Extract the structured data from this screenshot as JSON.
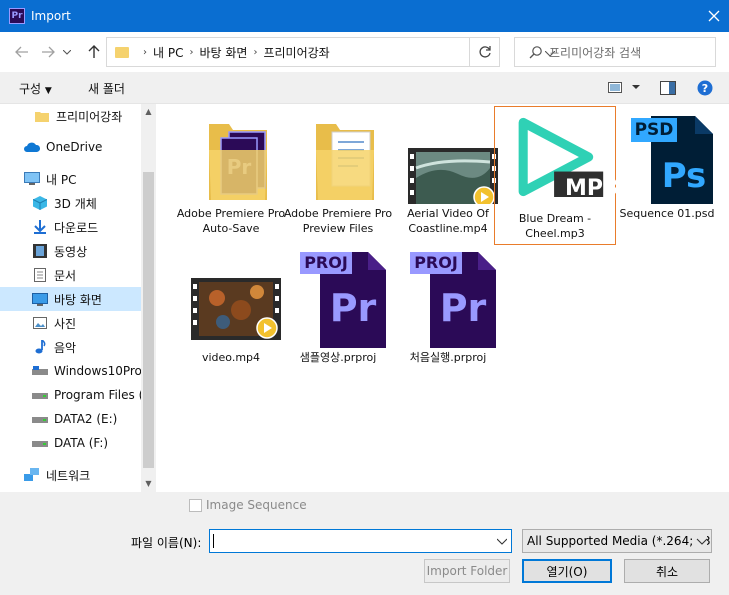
{
  "window": {
    "title": "Import",
    "app_icon_label": "Pr"
  },
  "address": {
    "breadcrumbs": [
      "내 PC",
      "바탕 화면",
      "프리미어강좌"
    ],
    "search_placeholder": "프리미어강좌 검색"
  },
  "toolbar": {
    "organize_label": "구성",
    "new_folder_label": "새 폴더"
  },
  "sidebar": {
    "items": [
      {
        "label": "프리미어강좌",
        "icon": "folder-icon"
      },
      {
        "label": "OneDrive",
        "icon": "cloud-icon"
      },
      {
        "label": "내 PC",
        "icon": "computer-icon"
      },
      {
        "label": "3D 개체",
        "icon": "cube-icon"
      },
      {
        "label": "다운로드",
        "icon": "download-icon"
      },
      {
        "label": "동영상",
        "icon": "film-icon"
      },
      {
        "label": "문서",
        "icon": "document-icon"
      },
      {
        "label": "바탕 화면",
        "icon": "desktop-icon"
      },
      {
        "label": "사진",
        "icon": "picture-icon"
      },
      {
        "label": "음악",
        "icon": "music-icon"
      },
      {
        "label": "Windows10Pro",
        "icon": "drive-icon"
      },
      {
        "label": "Program Files (D",
        "icon": "drive-icon"
      },
      {
        "label": "DATA2 (E:)",
        "icon": "drive-icon"
      },
      {
        "label": "DATA (F:)",
        "icon": "drive-icon"
      },
      {
        "label": "네트워크",
        "icon": "network-icon"
      }
    ],
    "selected": "바탕 화면"
  },
  "files": [
    {
      "name": "Adobe Premiere Pro Auto-Save",
      "kind": "folder-premiere"
    },
    {
      "name": "Adobe Premiere Pro Preview Files",
      "kind": "folder-docs"
    },
    {
      "name": "Aerial Video Of Coastline.mp4",
      "kind": "video"
    },
    {
      "name": "Blue Dream - Cheel.mp3",
      "kind": "mp3"
    },
    {
      "name": "Sequence 01.psd",
      "kind": "psd"
    },
    {
      "name": "video.mp4",
      "kind": "video2"
    },
    {
      "name": "샘플영상.prproj",
      "kind": "prproj"
    },
    {
      "name": "처음실행.prproj",
      "kind": "prproj"
    }
  ],
  "badges": {
    "mp3": "MP3",
    "psd": "PSD",
    "psd_letters": "Ps",
    "proj": "PROJ",
    "pr_letters": "Pr"
  },
  "bottom": {
    "image_sequence_label": "Image Sequence",
    "filename_label": "파일 이름(N):",
    "filename_value": "",
    "filetype_value": "All Supported Media (*.264;*.3",
    "import_folder_label": "Import Folder",
    "open_label": "열기(O)",
    "cancel_label": "취소"
  },
  "colors": {
    "titlebar": "#0a6ed1",
    "selection": "#cce8ff",
    "mp3_teal": "#2fd1b5",
    "premiere_purple": "#2b0a57",
    "premiere_violet": "#9999ff",
    "photoshop_blue": "#31a8ff",
    "photoshop_dark": "#001e36"
  }
}
